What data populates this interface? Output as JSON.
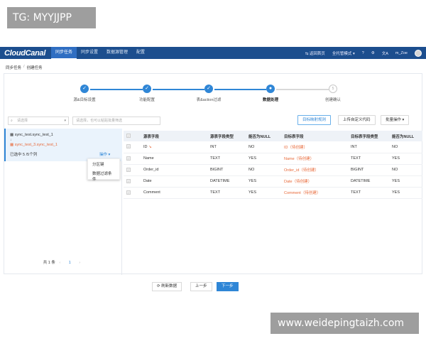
{
  "watermarks": {
    "top": "TG: MYYJJPP",
    "bottom": "www.weidepingtaizh.com"
  },
  "nav": {
    "logo": "CloudCanal",
    "items": [
      "同步任务",
      "同步设置",
      "数据源管理",
      "配置"
    ],
    "active_index": 0,
    "right": {
      "home": "返回首页",
      "mode": "全托管模式",
      "help_icon": "?",
      "settings_icon": "⚙",
      "lang_icon": "文A",
      "user": "m_Zoe"
    }
  },
  "breadcrumb": {
    "parent": "同步任务",
    "sep": "/",
    "current": "创建任务"
  },
  "steps": [
    {
      "label": "源&目标设置",
      "status": "done"
    },
    {
      "label": "功能配置",
      "status": "done"
    },
    {
      "label": "表&action过滤",
      "status": "done"
    },
    {
      "label": "数据处理",
      "status": "current"
    },
    {
      "label": "创建确认",
      "status": "todo",
      "number": "5"
    }
  ],
  "toolbar": {
    "select_placeholder": "请选择",
    "search_placeholder": "请选择，也可以粘贴批量筛选",
    "btn_target": "目标映射规则",
    "btn_upload": "上传自定义代码",
    "btn_batch": "批量操作"
  },
  "left": {
    "task": {
      "source": "sync_test.sync_test_1",
      "arrow": "↓",
      "target": "sync_test_3.sync_test_1",
      "selected": "已选中 5 /5个列",
      "op": "操作"
    },
    "dropdown": [
      "分区键",
      "数据过滤条件"
    ],
    "pager": {
      "total": "共 1 条",
      "page": "1",
      "prev": "‹",
      "next": "›"
    }
  },
  "table": {
    "headers": [
      "源表字段",
      "源表字段类型",
      "能否为NULL",
      "目标表字段",
      "目标表字段类型",
      "能否为NULL"
    ],
    "rows": [
      {
        "src": "ID",
        "key": true,
        "src_type": "INT",
        "src_null": "NO",
        "tgt": "ID（待创建）",
        "tgt_type": "INT",
        "tgt_null": "NO"
      },
      {
        "src": "Name",
        "key": false,
        "src_type": "TEXT",
        "src_null": "YES",
        "tgt": "Name（待创建）",
        "tgt_type": "TEXT",
        "tgt_null": "YES"
      },
      {
        "src": "Order_id",
        "key": false,
        "src_type": "BIGINT",
        "src_null": "NO",
        "tgt": "Order_id（待创建）",
        "tgt_type": "BIGINT",
        "tgt_null": "NO"
      },
      {
        "src": "Date",
        "key": false,
        "src_type": "DATETIME",
        "src_null": "YES",
        "tgt": "Date（待创建）",
        "tgt_type": "DATETIME",
        "tgt_null": "YES"
      },
      {
        "src": "Comment",
        "key": false,
        "src_type": "TEXT",
        "src_null": "YES",
        "tgt": "Comment（待创建）",
        "tgt_type": "TEXT",
        "tgt_null": "YES"
      }
    ]
  },
  "footer": {
    "refresh": "刷新数据",
    "prev": "上一步",
    "next": "下一步"
  },
  "colors": {
    "nav": "#1c4e8e",
    "primary": "#2f86d6",
    "target_text": "#e86a3a"
  }
}
